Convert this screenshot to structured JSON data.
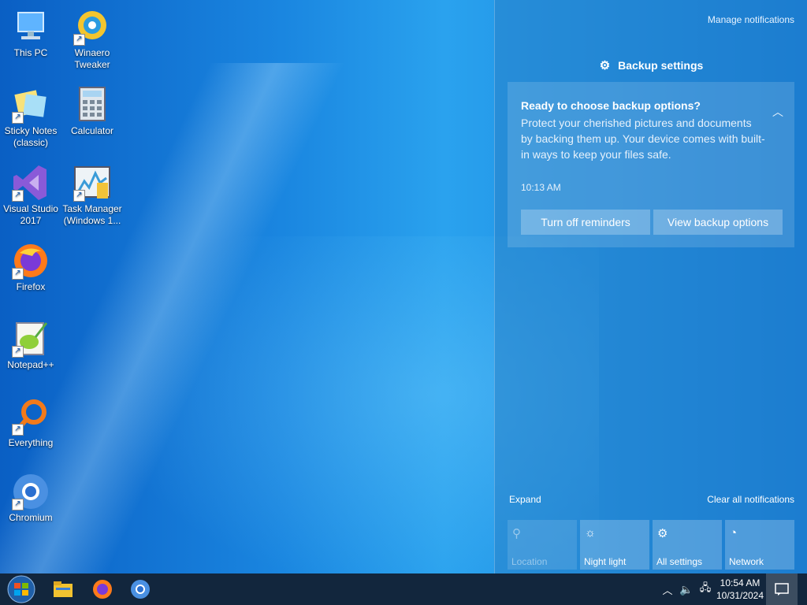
{
  "desktop": {
    "icons": [
      {
        "name": "this-pc-icon",
        "label": "This PC"
      },
      {
        "name": "winaero-tweaker-icon",
        "label": "Winaero\nTweaker"
      },
      {
        "name": "sticky-notes-icon",
        "label": "Sticky Notes\n(classic)"
      },
      {
        "name": "calculator-icon",
        "label": "Calculator"
      },
      {
        "name": "visual-studio-icon",
        "label": "Visual Studio\n2017"
      },
      {
        "name": "task-manager-icon",
        "label": "Task Manager\n(Windows 1..."
      },
      {
        "name": "firefox-icon",
        "label": "Firefox"
      },
      {
        "name": "notepadpp-icon",
        "label": "Notepad++"
      },
      {
        "name": "everything-icon",
        "label": "Everything"
      },
      {
        "name": "chromium-icon",
        "label": "Chromium"
      }
    ]
  },
  "action_center": {
    "manage_label": "Manage notifications",
    "group_title": "Backup settings",
    "notification": {
      "title": "Ready to choose backup options?",
      "body": "Protect your cherished pictures and documents by backing them up. Your device comes with built-in ways to keep your files safe.",
      "time": "10:13 AM",
      "button1": "Turn off reminders",
      "button2": "View backup options"
    },
    "expand_label": "Expand",
    "clear_label": "Clear all notifications",
    "tiles": [
      {
        "label": "Location",
        "icon": "location-icon"
      },
      {
        "label": "Night light",
        "icon": "night-light-icon"
      },
      {
        "label": "All settings",
        "icon": "gear-icon"
      },
      {
        "label": "Network",
        "icon": "network-icon"
      }
    ]
  },
  "taskbar": {
    "time": "10:54 AM",
    "date": "10/31/2024"
  }
}
